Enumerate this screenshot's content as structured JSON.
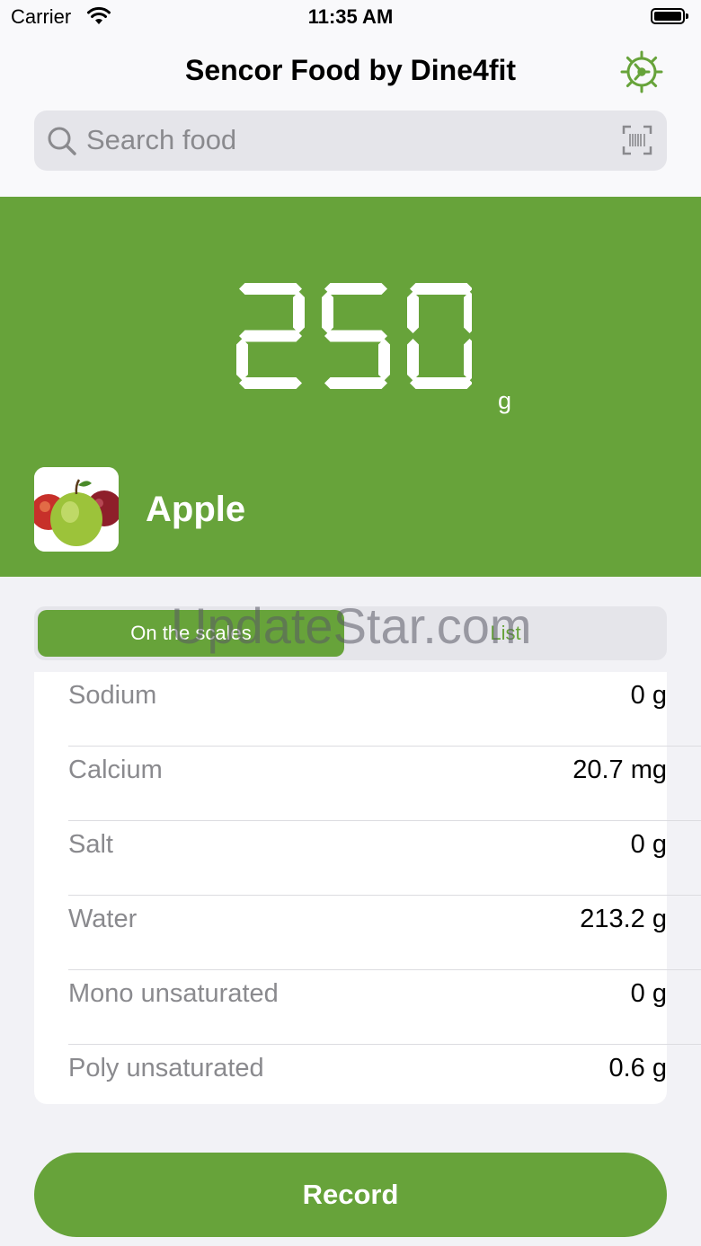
{
  "status_bar": {
    "carrier": "Carrier",
    "time": "11:35 AM"
  },
  "header": {
    "title": "Sencor Food by Dine4fit",
    "settings_icon": "gear-icon"
  },
  "search": {
    "placeholder": "Search food",
    "icon": "search-icon",
    "barcode_icon": "barcode-scan-icon"
  },
  "scale": {
    "weight": "250",
    "unit": "g"
  },
  "food": {
    "name": "Apple",
    "image_icon": "apple-photo"
  },
  "segments": {
    "active": "On the scales",
    "inactive": "List"
  },
  "nutrients": [
    {
      "name": "Sodium",
      "value": "0 g"
    },
    {
      "name": "Calcium",
      "value": "20.7 mg"
    },
    {
      "name": "Salt",
      "value": "0 g"
    },
    {
      "name": "Water",
      "value": "213.2 g"
    },
    {
      "name": "Mono unsaturated",
      "value": "0 g"
    },
    {
      "name": "Poly unsaturated",
      "value": "0.6 g"
    }
  ],
  "actions": {
    "record_label": "Record"
  },
  "watermark": "UpdateStar.com",
  "colors": {
    "accent": "#67a33a",
    "background": "#f2f2f6"
  }
}
